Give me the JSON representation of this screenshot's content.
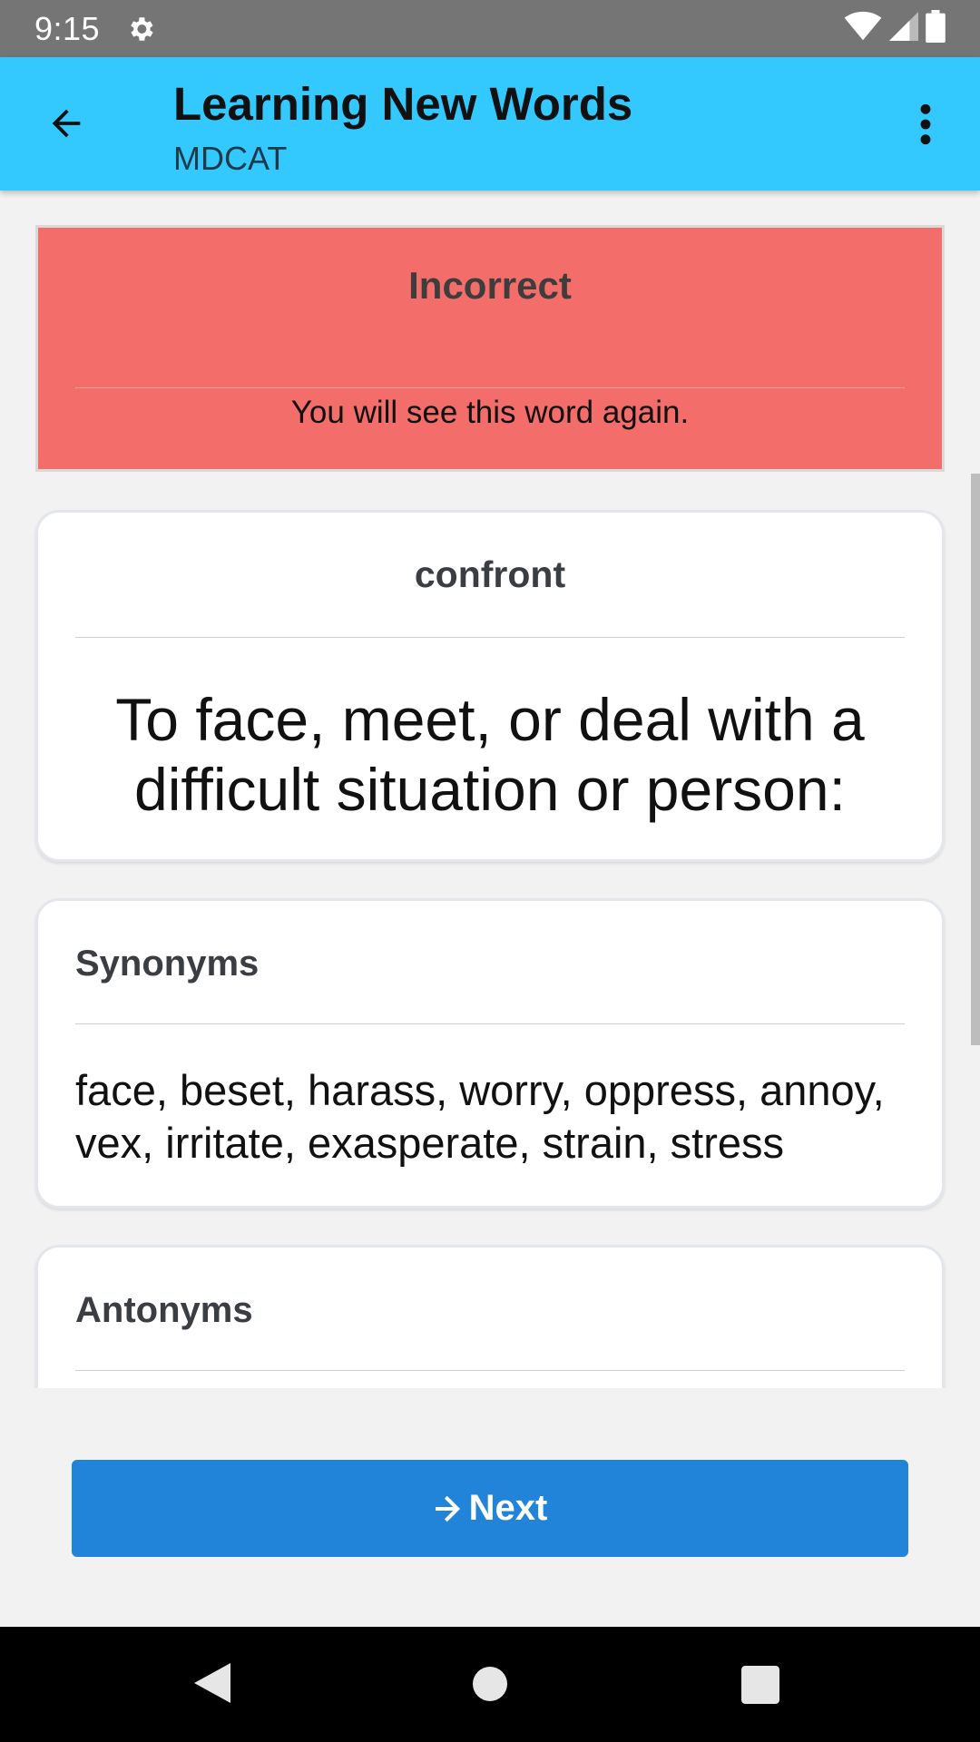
{
  "status_bar": {
    "time": "9:15"
  },
  "app_bar": {
    "title": "Learning New Words",
    "subtitle": "MDCAT"
  },
  "result_banner": {
    "title": "Incorrect",
    "message": "You will see this word again."
  },
  "word_card": {
    "word": "confront",
    "definition": "To face, meet, or deal with a difficult situation or person:"
  },
  "synonyms": {
    "heading": "Synonyms",
    "text": "face, beset, harass, worry, oppress, annoy, vex, irritate, exasperate, strain, stress"
  },
  "antonyms": {
    "heading": "Antonyms"
  },
  "next_button": {
    "label": "Next"
  },
  "colors": {
    "app_bar": "#33c9ff",
    "incorrect_banner": "#f36d6a",
    "next_button": "#2184d8"
  },
  "icons": [
    "gear-icon",
    "wifi-icon",
    "signal-icon",
    "battery-icon",
    "back-arrow-icon",
    "more-vert-icon",
    "arrow-right-icon",
    "nav-back-icon",
    "nav-home-icon",
    "nav-recents-icon"
  ]
}
